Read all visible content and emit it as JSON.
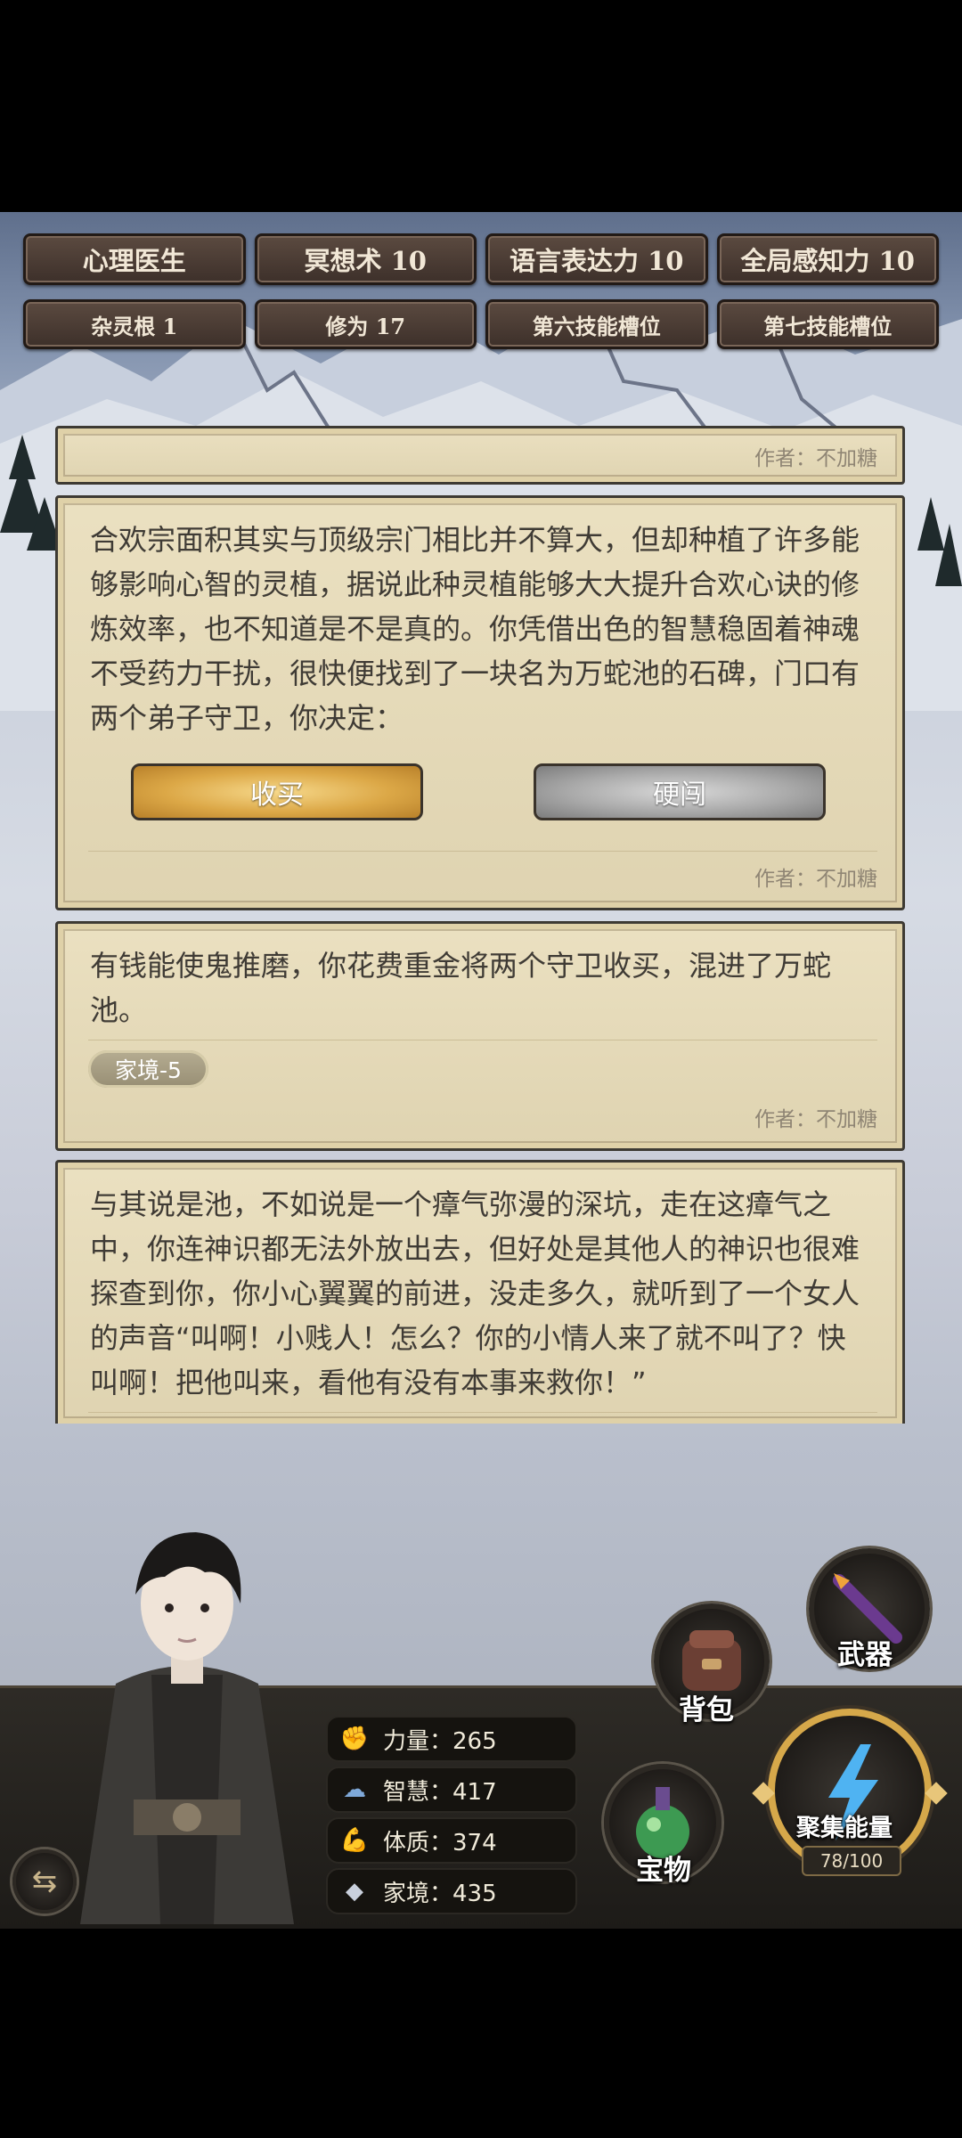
{
  "skills_row1": [
    "心理医生",
    "冥想术 10",
    "语言表达力 10",
    "全局感知力 10"
  ],
  "skills_row2": [
    "杂灵根 1",
    "修为 17",
    "第六技能槽位",
    "第七技能槽位"
  ],
  "card0": {
    "author": "作者：不加糖"
  },
  "card1": {
    "text": "合欢宗面积其实与顶级宗门相比并不算大，但却种植了许多能够影响心智的灵植，据说此种灵植能够大大提升合欢心诀的修炼效率，也不知道是不是真的。你凭借出色的智慧稳固着神魂不受药力干扰，很快便找到了一块名为万蛇池的石碑，门口有两个弟子守卫，你决定：",
    "choice_a": "收买",
    "choice_b": "硬闯",
    "author": "作者：不加糖"
  },
  "card2": {
    "text": "有钱能使鬼推磨，你花费重金将两个守卫收买，混进了万蛇池。",
    "badge": "家境-5",
    "author": "作者：不加糖"
  },
  "card3": {
    "text": "与其说是池，不如说是一个瘴气弥漫的深坑，走在这瘴气之中，你连神识都无法外放出去，但好处是其他人的神识也很难探查到你，你小心翼翼的前进，没走多久，就听到了一个女人的声音“叫啊！小贱人！怎么？你的小情人来了就不叫了？快叫啊！把他叫来，看他有没有本事来救你！”"
  },
  "stats": {
    "strength": "力量：265",
    "wisdom": "智慧：417",
    "physique": "体质：374",
    "family": "家境：435"
  },
  "actions": {
    "weapon": "武器",
    "bag": "背包",
    "treasure": "宝物",
    "gather": "聚集能量",
    "energy": "78/100"
  },
  "energy_fraction": 0.78,
  "colors": {
    "gold": "#dca847",
    "card": "#e8dcb8",
    "bar": "#1d1b18"
  }
}
